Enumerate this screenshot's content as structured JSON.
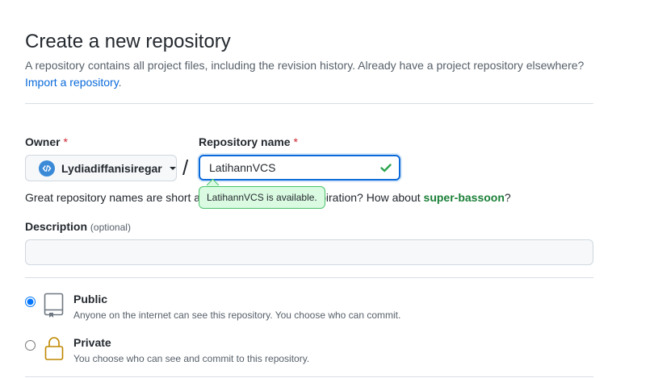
{
  "header": {
    "title": "Create a new repository",
    "subtitle": "A repository contains all project files, including the revision history. Already have a project repository elsewhere?",
    "import_link": "Import a repository"
  },
  "owner": {
    "label": "Owner",
    "required_mark": "*",
    "value": "Lydiadiffanisiregar",
    "slash": "/"
  },
  "repository": {
    "label": "Repository name",
    "required_mark": "*",
    "value": "LatihannVCS",
    "availability": "LatihannVCS is available.",
    "hint_prefix": "Great repository names are short a",
    "hint_middle": "spiration? How about",
    "suggestion": "super-bassoon",
    "hint_suffix": "?"
  },
  "description": {
    "label": "Description",
    "optional": "(optional)",
    "value": ""
  },
  "visibility": {
    "options": [
      {
        "title": "Public",
        "desc": "Anyone on the internet can see this repository. You choose who can commit.",
        "checked": true
      },
      {
        "title": "Private",
        "desc": "You choose who can see and commit to this repository.",
        "checked": false
      }
    ]
  },
  "colors": {
    "accent": "#0969da",
    "success": "#2da44e",
    "success_bg": "#dafbe1",
    "danger": "#cf222e"
  }
}
